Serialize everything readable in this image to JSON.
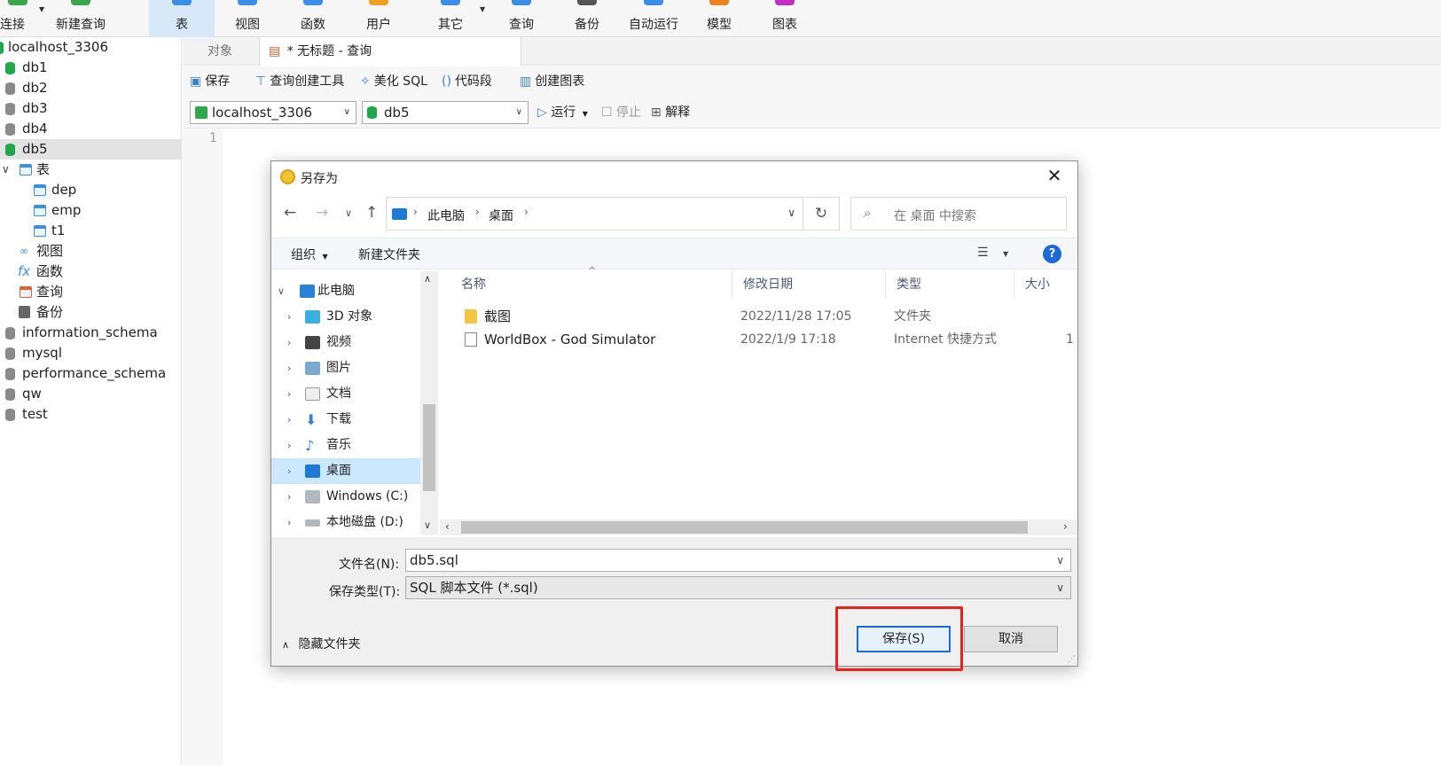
{
  "toolbar": {
    "items": [
      {
        "label": "连接",
        "icon": "connect-icon",
        "color": "#3aa54a"
      },
      {
        "label": "新建查询",
        "icon": "new-query-icon",
        "color": "#3aa54a"
      },
      {
        "label": "表",
        "icon": "table-icon",
        "color": "#3a8ee6"
      },
      {
        "label": "视图",
        "icon": "view-icon",
        "color": "#3a8ee6"
      },
      {
        "label": "函数",
        "icon": "function-icon",
        "color": "#3a8ee6"
      },
      {
        "label": "用户",
        "icon": "user-icon",
        "color": "#f0a020"
      },
      {
        "label": "其它",
        "icon": "other-icon",
        "color": "#3a8ee6"
      },
      {
        "label": "查询",
        "icon": "query-icon",
        "color": "#3a8ee6"
      },
      {
        "label": "备份",
        "icon": "backup-icon",
        "color": "#555555"
      },
      {
        "label": "自动运行",
        "icon": "automation-icon",
        "color": "#3a8ee6"
      },
      {
        "label": "模型",
        "icon": "model-icon",
        "color": "#f08020"
      },
      {
        "label": "图表",
        "icon": "chart-icon",
        "color": "#c030c0"
      }
    ]
  },
  "tree": {
    "connection": "localhost_3306",
    "databases": [
      "db1",
      "db2",
      "db3",
      "db4",
      "db5"
    ],
    "tables_label": "表",
    "tables": [
      "dep",
      "emp",
      "t1"
    ],
    "db5_children": [
      "视图",
      "函数",
      "查询",
      "备份"
    ],
    "other_databases": [
      "information_schema",
      "mysql",
      "performance_schema",
      "qw",
      "test"
    ]
  },
  "tabs": {
    "objects": "对象",
    "query": "* 无标题 - 查询"
  },
  "query_toolbar": {
    "save": "保存",
    "query_builder": "查询创建工具",
    "beautify": "美化 SQL",
    "code_snippet": "代码段",
    "create_chart": "创建图表"
  },
  "conn_bar": {
    "connection": "localhost_3306",
    "database": "db5",
    "run": "运行",
    "stop": "停止",
    "explain": "解释"
  },
  "editor": {
    "line_number": "1"
  },
  "dialog": {
    "title": "另存为",
    "breadcrumb": [
      "此电脑",
      "桌面"
    ],
    "search_placeholder": "在 桌面 中搜索",
    "organize": "组织",
    "new_folder": "新建文件夹",
    "help": "?",
    "nav_tree": [
      {
        "label": "此电脑",
        "expanded": true
      },
      {
        "label": "3D 对象"
      },
      {
        "label": "视频"
      },
      {
        "label": "图片"
      },
      {
        "label": "文档"
      },
      {
        "label": "下载"
      },
      {
        "label": "音乐"
      },
      {
        "label": "桌面",
        "selected": true
      },
      {
        "label": "Windows (C:)"
      },
      {
        "label": "本地磁盘 (D:)"
      }
    ],
    "columns": {
      "name": "名称",
      "date": "修改日期",
      "type": "类型",
      "size": "大小"
    },
    "files": [
      {
        "name": "截图",
        "date": "2022/11/28 17:05",
        "type": "文件夹",
        "size": ""
      },
      {
        "name": "WorldBox - God Simulator",
        "date": "2022/1/9 17:18",
        "type": "Internet 快捷方式",
        "size": "1"
      }
    ],
    "filename_label": "文件名(N):",
    "filename_value": "db5.sql",
    "filetype_label": "保存类型(T):",
    "filetype_value": "SQL 脚本文件 (*.sql)",
    "hide_folders": "隐藏文件夹",
    "save_button": "保存(S)",
    "cancel_button": "取消"
  },
  "colors": {
    "accent": "#1b6ad8",
    "highlight_box": "#e8231b",
    "db_active": "#1ea84a"
  }
}
